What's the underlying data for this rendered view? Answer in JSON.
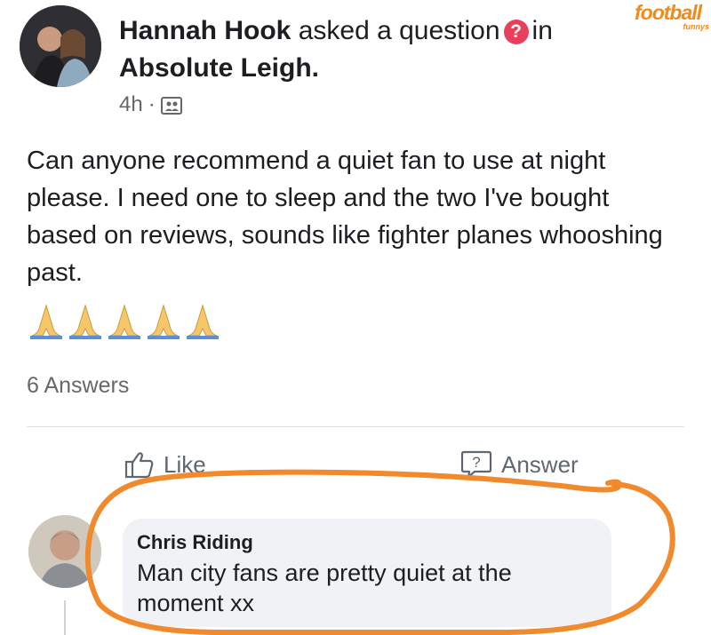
{
  "post": {
    "author": "Hannah Hook",
    "action_text": "asked a question",
    "in_text": "in",
    "group": "Absolute Leigh.",
    "time": "4h",
    "meta_separator": "·",
    "body": "Can anyone recommend a quiet fan to use at night please. I need one to sleep and the two I've bought based on reviews, sounds like fighter planes whooshing past.",
    "emoji_count": 5,
    "answers_count": "6 Answers"
  },
  "actions": {
    "like": "Like",
    "answer": "Answer"
  },
  "comment": {
    "author": "Chris Riding",
    "text": "Man city fans are pretty quiet at the moment xx"
  },
  "watermark": {
    "brand": "football",
    "sub": "funnys"
  },
  "colors": {
    "question_badge": "#e8405a",
    "highlight_circle": "#f08a2c",
    "watermark": "#f28a1a"
  }
}
